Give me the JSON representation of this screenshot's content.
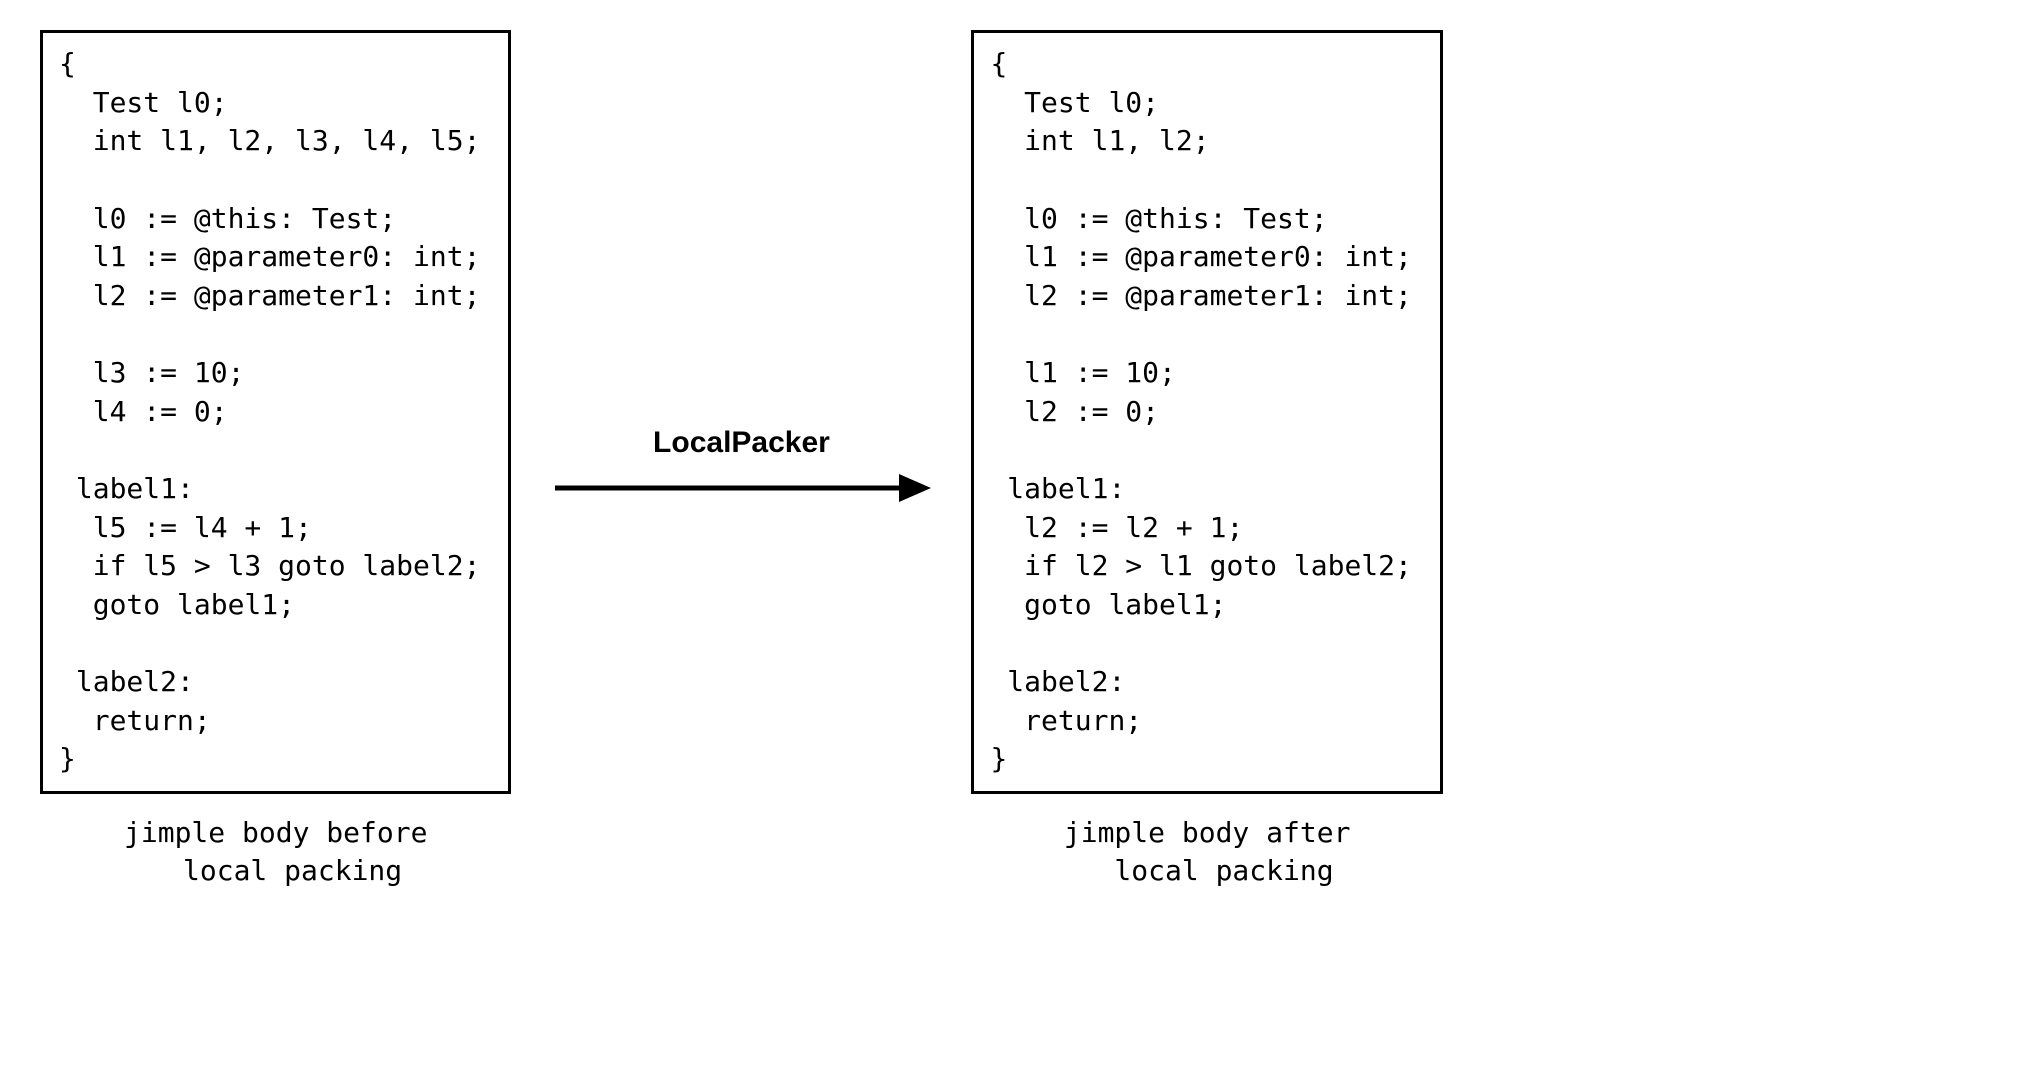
{
  "left": {
    "code": "{\n  Test l0;\n  int l1, l2, l3, l4, l5;\n\n  l0 := @this: Test;\n  l1 := @parameter0: int;\n  l2 := @parameter1: int;\n\n  l3 := 10;\n  l4 := 0;\n\n label1:\n  l5 := l4 + 1;\n  if l5 > l3 goto label2;\n  goto label1;\n\n label2:\n  return;\n}",
    "caption": "jimple body before\n  local packing"
  },
  "arrow": {
    "label": "LocalPacker"
  },
  "right": {
    "code": "{\n  Test l0;\n  int l1, l2;\n\n  l0 := @this: Test;\n  l1 := @parameter0: int;\n  l2 := @parameter1: int;\n\n  l1 := 10;\n  l2 := 0;\n\n label1:\n  l2 := l2 + 1;\n  if l2 > l1 goto label2;\n  goto label1;\n\n label2:\n  return;\n}",
    "caption": "jimple body after\n  local packing"
  }
}
